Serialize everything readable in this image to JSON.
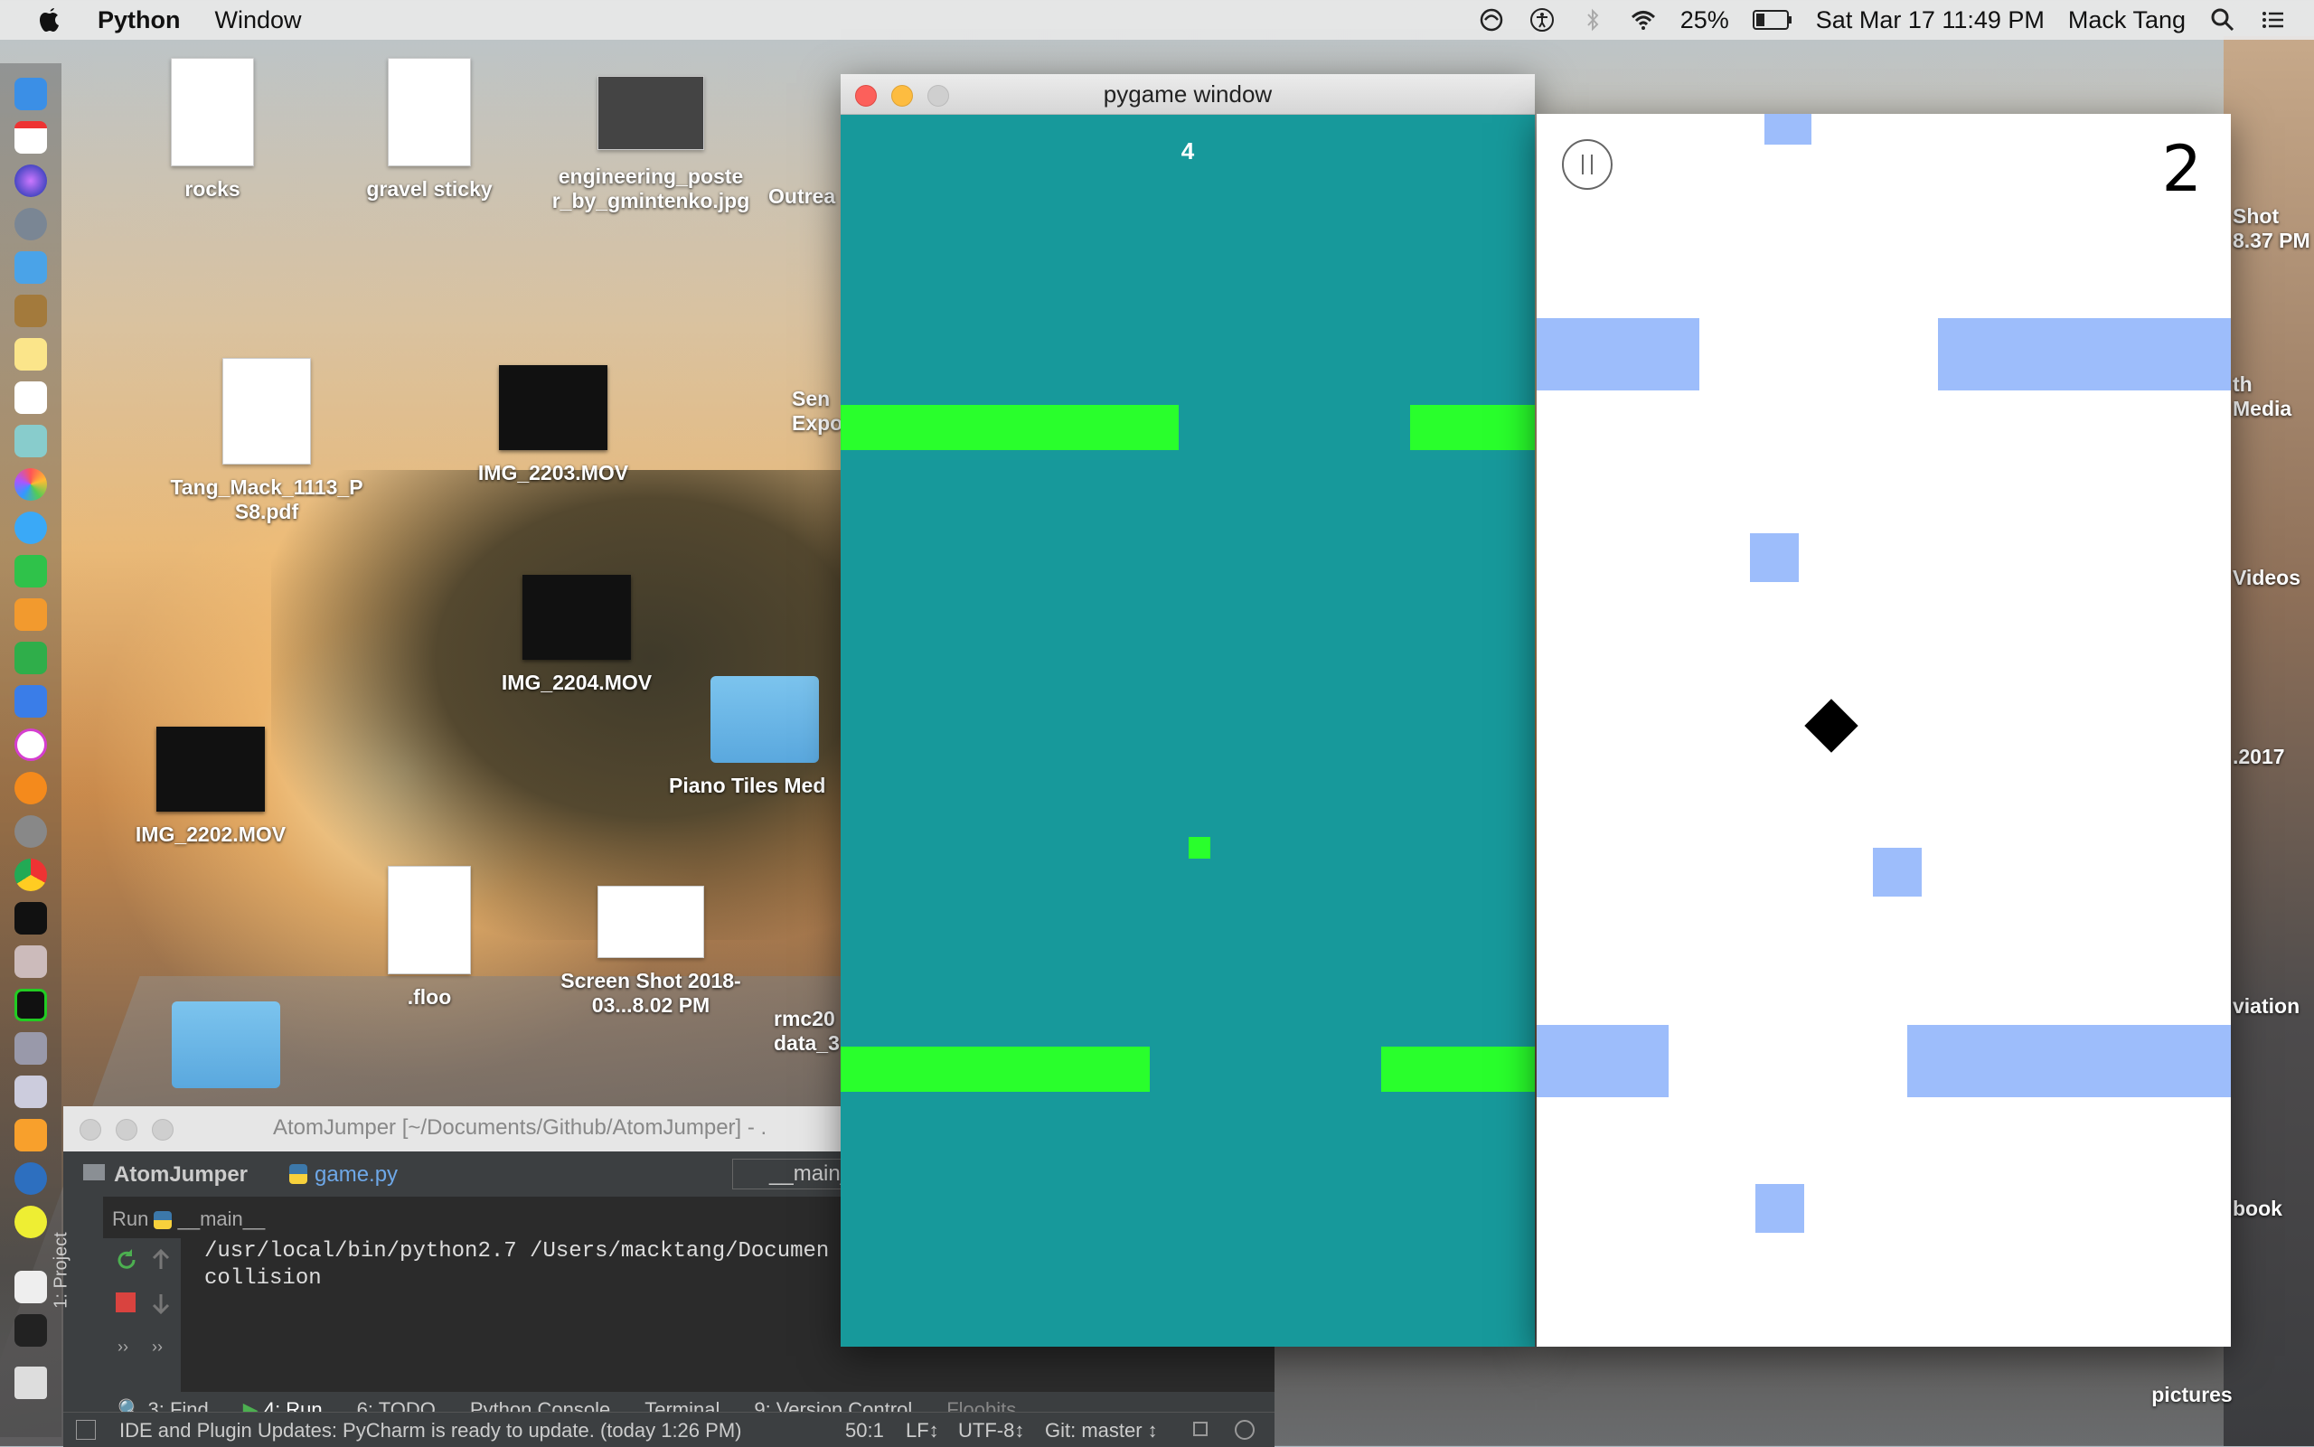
{
  "menubar": {
    "app_name": "Python",
    "menu_window": "Window",
    "battery": "25%",
    "datetime": "Sat Mar 17  11:49 PM",
    "user": "Mack Tang"
  },
  "desktop": {
    "rocks": "rocks",
    "gravel": "gravel sticky",
    "poster": "engineering_poste r_by_gmintenko.jpg",
    "outreach": "Outrea",
    "tang_pdf": "Tang_Mack_1113_P S8.pdf",
    "img2203": "IMG_2203.MOV",
    "img2204": "IMG_2204.MOV",
    "img2202": "IMG_2202.MOV",
    "piano": "Piano Tiles Med",
    "floo": ".floo",
    "screenshot": "Screen Shot 2018-03...8.02 PM",
    "rmc": "rmc20 data_3",
    "sen": "Sen Expo",
    "r_shot": "Shot 8.37 PM",
    "r_media": "th Media",
    "r_videos": "Videos",
    "r_2017": ".2017",
    "r_aviation": "viation",
    "r_book": "book",
    "r_pictures": "pictures"
  },
  "pygame": {
    "title": "pygame window",
    "score": "4"
  },
  "game2": {
    "score": "2"
  },
  "pycharm": {
    "title": "AtomJumper [~/Documents/Github/AtomJumper] - .",
    "project": "AtomJumper",
    "file": "game.py",
    "config": "__main_",
    "run_label": "Run",
    "run_config": "__main__",
    "side_label": "1: Project",
    "output_line1": "/usr/local/bin/python2.7 /Users/macktang/Documen",
    "output_line2": "collision",
    "tabs": [
      "3: Find",
      "4: Run",
      "6: TODO",
      "Python Console",
      "Terminal",
      "9: Version Control",
      "Floobits"
    ],
    "status": "IDE and Plugin Updates: PyCharm is ready to update. (today 1:26 PM)",
    "position": "50:1",
    "line_sep": "LF↕",
    "encoding": "UTF-8↕",
    "git": "Git: master ↕"
  }
}
